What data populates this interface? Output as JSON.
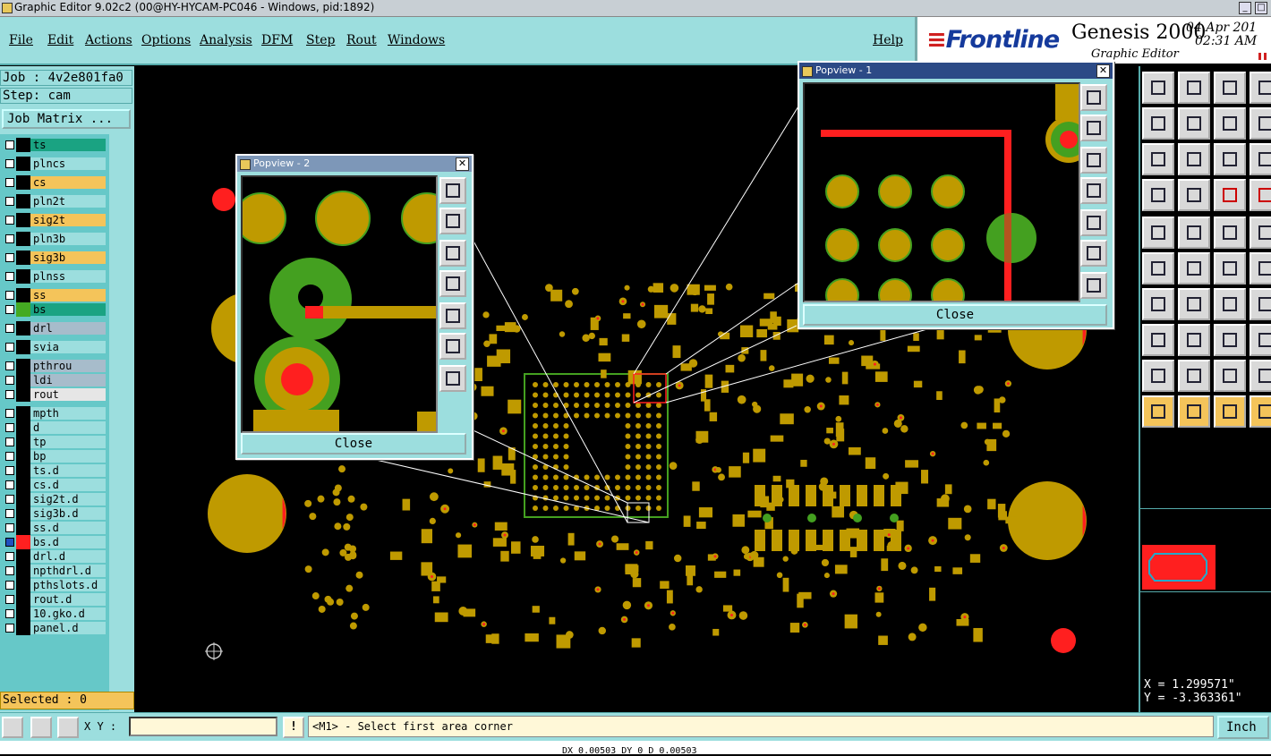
{
  "window": {
    "title": "Graphic Editor 9.02c2 (00@HY-HYCAM-PC046 - Windows, pid:1892)"
  },
  "menu": [
    "File",
    "Edit",
    "Actions",
    "Options",
    "Analysis",
    "DFM",
    "Step",
    "Rout",
    "Windows"
  ],
  "help": "Help",
  "brand": {
    "logo": "Frontline",
    "product": "Genesis 2000",
    "subtitle": "Graphic Editor",
    "date": "04 Apr 201",
    "time": "02:31 AM"
  },
  "job": {
    "job": "Job : 4v2e801fa0",
    "step": "Step: cam",
    "matrix_button": "Job Matrix ..."
  },
  "layers": [
    {
      "name": "ts",
      "bg": "#1aa382",
      "color": "#000"
    },
    {
      "name": "plncs",
      "bg": "#9cdede",
      "color": "#000"
    },
    {
      "name": "cs",
      "bg": "#f4c45a",
      "color": "#000"
    },
    {
      "name": "pln2t",
      "bg": "#9cdede",
      "color": "#000"
    },
    {
      "name": "sig2t",
      "bg": "#f4c45a",
      "color": "#000"
    },
    {
      "name": "pln3b",
      "bg": "#9cdede",
      "color": "#000"
    },
    {
      "name": "sig3b",
      "bg": "#f4c45a",
      "color": "#000"
    },
    {
      "name": "plnss",
      "bg": "#9cdede",
      "color": "#000"
    },
    {
      "name": "ss",
      "bg": "#f4c45a",
      "color": "#000"
    },
    {
      "name": "bs",
      "bg": "#1aa382",
      "color": "#44aa22"
    },
    {
      "name": "drl",
      "bg": "#a7bccb",
      "color": "#000"
    },
    {
      "name": "svia",
      "bg": "#9cdede",
      "color": "#000"
    },
    {
      "name": "pthrou",
      "bg": "#a7bccb",
      "color": "#000"
    },
    {
      "name": "ldi",
      "bg": "#a7bccb",
      "color": "#000"
    },
    {
      "name": "rout",
      "bg": "#e6e6e6",
      "color": "#000"
    },
    {
      "name": "mpth",
      "bg": "#9cdede",
      "color": "#000"
    },
    {
      "name": "d",
      "bg": "#9cdede",
      "color": "#000"
    },
    {
      "name": "tp",
      "bg": "#9cdede",
      "color": "#000"
    },
    {
      "name": "bp",
      "bg": "#9cdede",
      "color": "#000"
    },
    {
      "name": "ts.d",
      "bg": "#9cdede",
      "color": "#000"
    },
    {
      "name": "cs.d",
      "bg": "#9cdede",
      "color": "#000"
    },
    {
      "name": "sig2t.d",
      "bg": "#9cdede",
      "color": "#000"
    },
    {
      "name": "sig3b.d",
      "bg": "#9cdede",
      "color": "#000"
    },
    {
      "name": "ss.d",
      "bg": "#9cdede",
      "color": "#000"
    },
    {
      "name": "bs.d",
      "bg": "#9cdede",
      "color": "#ff2020"
    },
    {
      "name": "drl.d",
      "bg": "#9cdede",
      "color": "#000"
    },
    {
      "name": "npthdrl.d",
      "bg": "#9cdede",
      "color": "#000"
    },
    {
      "name": "pthslots.d",
      "bg": "#9cdede",
      "color": "#000"
    },
    {
      "name": "rout.d",
      "bg": "#9cdede",
      "color": "#000"
    },
    {
      "name": "10.gko.d",
      "bg": "#9cdede",
      "color": "#000"
    },
    {
      "name": "panel.d",
      "bg": "#9cdede",
      "color": "#000"
    }
  ],
  "selected": "Selected : 0",
  "popview1": {
    "title": "Popview - 1",
    "close": "Close"
  },
  "popview2": {
    "title": "Popview - 2",
    "close": "Close"
  },
  "coords": {
    "x": "X = 1.299571\"",
    "y": "Y = -3.363361\""
  },
  "status": {
    "xy_label": "X Y :",
    "xy_value": "",
    "prompt": "<M1> - Select first area corner",
    "units": "Inch"
  },
  "bottom": "DX 0.00503 DY 0 D 0.00503"
}
